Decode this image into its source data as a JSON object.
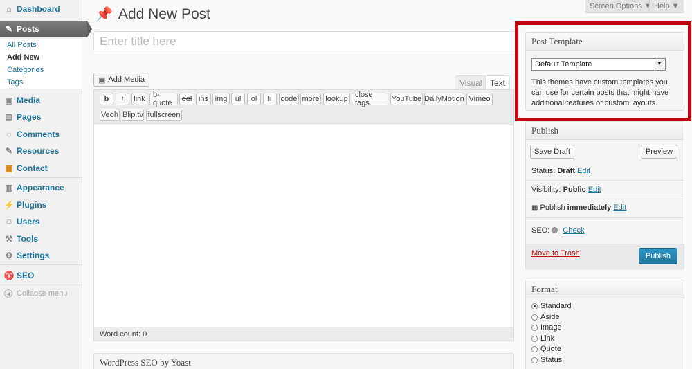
{
  "sidebar": {
    "items": [
      {
        "label": "Dashboard",
        "icon": "home-icon"
      },
      {
        "label": "Posts",
        "icon": "pin-icon"
      },
      {
        "label": "Media",
        "icon": "media-icon"
      },
      {
        "label": "Pages",
        "icon": "pages-icon"
      },
      {
        "label": "Comments",
        "icon": "comment-icon"
      },
      {
        "label": "Resources",
        "icon": "pin-icon"
      },
      {
        "label": "Contact",
        "icon": "contact-icon"
      },
      {
        "label": "Appearance",
        "icon": "appearance-icon"
      },
      {
        "label": "Plugins",
        "icon": "plugin-icon"
      },
      {
        "label": "Users",
        "icon": "users-icon"
      },
      {
        "label": "Tools",
        "icon": "tools-icon"
      },
      {
        "label": "Settings",
        "icon": "settings-icon"
      },
      {
        "label": "SEO",
        "icon": "seo-icon"
      }
    ],
    "submenu": [
      "All Posts",
      "Add New",
      "Categories",
      "Tags"
    ],
    "collapse": "Collapse menu"
  },
  "topbar": {
    "screen_options": "Screen Options ▼",
    "help": "Help ▼"
  },
  "page": {
    "title": "Add New Post",
    "title_placeholder": "Enter title here"
  },
  "editor": {
    "add_media": "Add Media",
    "tab_visual": "Visual",
    "tab_text": "Text",
    "buttons_row1": [
      "b",
      "i",
      "link",
      "b-quote",
      "del",
      "ins",
      "img",
      "ul",
      "ol",
      "li",
      "code",
      "more",
      "lookup",
      "close tags",
      "YouTube",
      "DailyMotion",
      "Vimeo"
    ],
    "buttons_row2": [
      "Veoh",
      "Blip.tv",
      "fullscreen"
    ],
    "word_count": "Word count: 0"
  },
  "seo_box": {
    "title": "WordPress SEO by Yoast"
  },
  "post_template": {
    "title": "Post Template",
    "selected": "Default Template",
    "description": "This themes have custom templates you can use for certain posts that might have additional features or custom layouts."
  },
  "publish": {
    "title": "Publish",
    "save_draft": "Save Draft",
    "preview": "Preview",
    "status_label": "Status:",
    "status_value": "Draft",
    "visibility_label": "Visibility:",
    "visibility_value": "Public",
    "publish_label": "Publish",
    "publish_value": "immediately",
    "edit": "Edit",
    "seo_label": "SEO:",
    "seo_check": "Check",
    "trash": "Move to Trash",
    "publish_button": "Publish"
  },
  "format": {
    "title": "Format",
    "options": [
      "Standard",
      "Aside",
      "Image",
      "Link",
      "Quote",
      "Status"
    ],
    "selected_index": 0
  },
  "colors": {
    "highlight": "#c2060f",
    "link": "#21759b",
    "publish": "#21759b"
  }
}
